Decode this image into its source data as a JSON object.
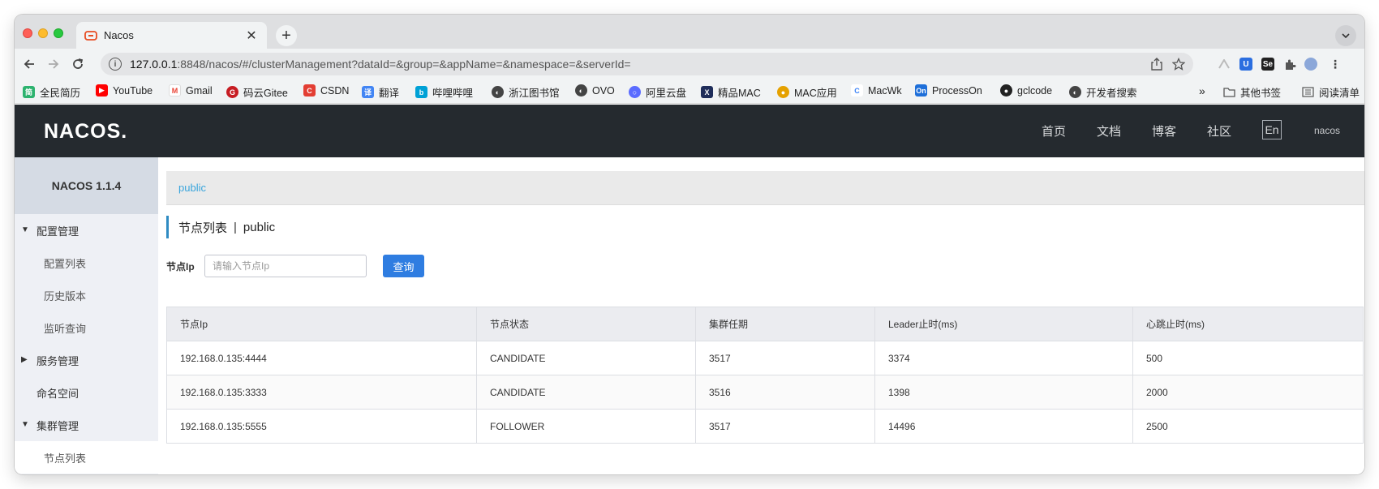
{
  "browser": {
    "tab_title": "Nacos",
    "tab_favicon": "nacos-icon",
    "url_host": "127.0.0.1",
    "url_rest": ":8848/nacos/#/clusterManagement?dataId=&group=&appName=&namespace=&serverId="
  },
  "bookmarks": [
    {
      "label": "全民简历",
      "icon": "resume-icon",
      "color": "#2db36f"
    },
    {
      "label": "YouTube",
      "icon": "youtube-icon",
      "color": "#ff0000"
    },
    {
      "label": "Gmail",
      "icon": "gmail-icon",
      "color": "#ea4335"
    },
    {
      "label": "码云Gitee",
      "icon": "gitee-icon",
      "color": "#c71d23"
    },
    {
      "label": "CSDN",
      "icon": "csdn-icon",
      "color": "#e33e33"
    },
    {
      "label": "翻译",
      "icon": "translate-icon",
      "color": "#4285f4"
    },
    {
      "label": "哔哩哔哩",
      "icon": "bilibili-icon",
      "color": "#00a1d6"
    },
    {
      "label": "浙江图书馆",
      "icon": "globe-icon",
      "color": "#444444"
    },
    {
      "label": "OVO",
      "icon": "globe-icon",
      "color": "#444444"
    },
    {
      "label": "阿里云盘",
      "icon": "aliyun-drive-icon",
      "color": "#5b6cff"
    },
    {
      "label": "精品MAC",
      "icon": "x-icon",
      "color": "#1f2d5a"
    },
    {
      "label": "MAC应用",
      "icon": "pineapple-icon",
      "color": "#e5a100"
    },
    {
      "label": "MacWk",
      "icon": "macwk-icon",
      "color": "#3a82f7"
    },
    {
      "label": "ProcessOn",
      "icon": "processon-icon",
      "color": "#1e6fd9"
    },
    {
      "label": "gclcode",
      "icon": "github-icon",
      "color": "#222222"
    },
    {
      "label": "开发者搜索",
      "icon": "globe-icon",
      "color": "#444444"
    },
    {
      "label": "其他书签",
      "icon": "folder-icon",
      "color": "#555555"
    },
    {
      "label": "阅读清单",
      "icon": "reading-list-icon",
      "color": "#555555"
    }
  ],
  "header": {
    "logo": "NACOS.",
    "nav": [
      "首页",
      "文档",
      "博客",
      "社区"
    ],
    "lang": "En",
    "user": "nacos"
  },
  "sidebar": {
    "version": "NACOS 1.1.4",
    "groups": [
      {
        "label": "配置管理",
        "expanded": true,
        "items": [
          "配置列表",
          "历史版本",
          "监听查询"
        ]
      },
      {
        "label": "服务管理",
        "expanded": false,
        "items": []
      },
      {
        "label": "命名空间",
        "expanded": null,
        "items": []
      },
      {
        "label": "集群管理",
        "expanded": true,
        "items": [
          "节点列表"
        ]
      }
    ],
    "active_item": "节点列表"
  },
  "main": {
    "namespace": "public",
    "title": "节点列表",
    "title_sep": "|",
    "title_ns": "public",
    "search_label": "节点Ip",
    "search_placeholder": "请输入节点Ip",
    "search_value": "",
    "search_button": "查询",
    "table": {
      "columns": [
        "节点Ip",
        "节点状态",
        "集群任期",
        "Leader止时(ms)",
        "心跳止时(ms)"
      ],
      "rows": [
        [
          "192.168.0.135:4444",
          "CANDIDATE",
          "3517",
          "3374",
          "500"
        ],
        [
          "192.168.0.135:3333",
          "CANDIDATE",
          "3516",
          "1398",
          "2000"
        ],
        [
          "192.168.0.135:5555",
          "FOLLOWER",
          "3517",
          "14496",
          "2500"
        ]
      ]
    }
  }
}
